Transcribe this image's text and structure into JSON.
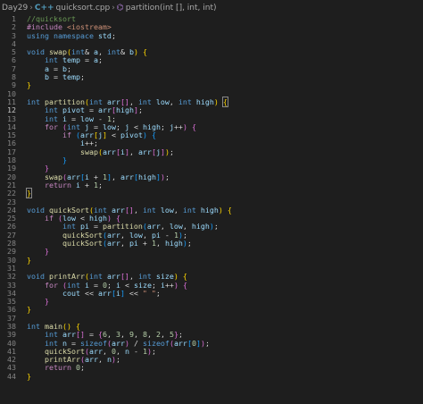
{
  "breadcrumb": {
    "folder": "Day29",
    "file_icon": "C++",
    "file": "quicksort.cpp",
    "symbol": "partition(int [], int, int)"
  },
  "editor": {
    "active_line": 12,
    "lines": [
      [
        [
          "//quicksort",
          "cmt"
        ]
      ],
      [
        [
          "#include ",
          "ctrl"
        ],
        [
          "<iostream>",
          "inc"
        ]
      ],
      [
        [
          "using ",
          "kw"
        ],
        [
          "namespace ",
          "kw"
        ],
        [
          "std",
          "var"
        ],
        [
          ";",
          ""
        ]
      ],
      [],
      [
        [
          "void ",
          "kw"
        ],
        [
          "swap",
          "fn"
        ],
        [
          "(",
          "b1"
        ],
        [
          "int",
          "kw"
        ],
        [
          "& ",
          ""
        ],
        [
          "a",
          "var"
        ],
        [
          ", ",
          ""
        ],
        [
          "int",
          "kw"
        ],
        [
          "& ",
          ""
        ],
        [
          "b",
          "var"
        ],
        [
          ")",
          "b1"
        ],
        [
          " ",
          ""
        ],
        [
          "{",
          "b1"
        ]
      ],
      [
        [
          "    ",
          ""
        ],
        [
          "int ",
          "kw"
        ],
        [
          "temp",
          "var"
        ],
        [
          " = ",
          ""
        ],
        [
          "a",
          "var"
        ],
        [
          ";",
          ""
        ]
      ],
      [
        [
          "    ",
          ""
        ],
        [
          "a",
          "var"
        ],
        [
          " = ",
          ""
        ],
        [
          "b",
          "var"
        ],
        [
          ";",
          ""
        ]
      ],
      [
        [
          "    ",
          ""
        ],
        [
          "b",
          "var"
        ],
        [
          " = ",
          ""
        ],
        [
          "temp",
          "var"
        ],
        [
          ";",
          ""
        ]
      ],
      [
        [
          "}",
          "b1"
        ]
      ],
      [],
      [
        [
          "int ",
          "kw"
        ],
        [
          "partition",
          "fn"
        ],
        [
          "(",
          "b1"
        ],
        [
          "int ",
          "kw"
        ],
        [
          "arr",
          "var"
        ],
        [
          "[]",
          "b2"
        ],
        [
          ", ",
          ""
        ],
        [
          "int ",
          "kw"
        ],
        [
          "low",
          "var"
        ],
        [
          ", ",
          ""
        ],
        [
          "int ",
          "kw"
        ],
        [
          "high",
          "var"
        ],
        [
          ")",
          "b1"
        ],
        [
          " ",
          ""
        ],
        [
          "{",
          "b1"
        ]
      ],
      [
        [
          "    ",
          ""
        ],
        [
          "int ",
          "kw"
        ],
        [
          "pivot",
          "var"
        ],
        [
          " = ",
          ""
        ],
        [
          "arr",
          "var"
        ],
        [
          "[",
          "b2"
        ],
        [
          "high",
          "var"
        ],
        [
          "]",
          "b2"
        ],
        [
          ";",
          ""
        ]
      ],
      [
        [
          "    ",
          ""
        ],
        [
          "int ",
          "kw"
        ],
        [
          "i",
          "var"
        ],
        [
          " = ",
          ""
        ],
        [
          "low",
          "var"
        ],
        [
          " - ",
          ""
        ],
        [
          "1",
          "num"
        ],
        [
          ";",
          ""
        ]
      ],
      [
        [
          "    ",
          ""
        ],
        [
          "for ",
          "ctrl"
        ],
        [
          "(",
          "b2"
        ],
        [
          "int ",
          "kw"
        ],
        [
          "j",
          "var"
        ],
        [
          " = ",
          ""
        ],
        [
          "low",
          "var"
        ],
        [
          "; ",
          ""
        ],
        [
          "j",
          "var"
        ],
        [
          " < ",
          ""
        ],
        [
          "high",
          "var"
        ],
        [
          "; ",
          ""
        ],
        [
          "j",
          "var"
        ],
        [
          "++",
          ""
        ],
        [
          ")",
          "b2"
        ],
        [
          " ",
          ""
        ],
        [
          "{",
          "b2"
        ]
      ],
      [
        [
          "        ",
          ""
        ],
        [
          "if ",
          "ctrl"
        ],
        [
          "(",
          "b3"
        ],
        [
          "arr",
          "var"
        ],
        [
          "[",
          "b1"
        ],
        [
          "j",
          "var"
        ],
        [
          "]",
          "b1"
        ],
        [
          " < ",
          ""
        ],
        [
          "pivot",
          "var"
        ],
        [
          ")",
          "b3"
        ],
        [
          " ",
          ""
        ],
        [
          "{",
          "b3"
        ]
      ],
      [
        [
          "            ",
          ""
        ],
        [
          "i",
          "var"
        ],
        [
          "++;",
          ""
        ]
      ],
      [
        [
          "            ",
          ""
        ],
        [
          "swap",
          "fn"
        ],
        [
          "(",
          "b1"
        ],
        [
          "arr",
          "var"
        ],
        [
          "[",
          "b2"
        ],
        [
          "i",
          "var"
        ],
        [
          "]",
          "b2"
        ],
        [
          ", ",
          ""
        ],
        [
          "arr",
          "var"
        ],
        [
          "[",
          "b2"
        ],
        [
          "j",
          "var"
        ],
        [
          "]",
          "b2"
        ],
        [
          ")",
          "b1"
        ],
        [
          ";",
          ""
        ]
      ],
      [
        [
          "        ",
          ""
        ],
        [
          "}",
          "b3"
        ]
      ],
      [
        [
          "    ",
          ""
        ],
        [
          "}",
          "b2"
        ]
      ],
      [
        [
          "    ",
          ""
        ],
        [
          "swap",
          "fn"
        ],
        [
          "(",
          "b2"
        ],
        [
          "arr",
          "var"
        ],
        [
          "[",
          "b3"
        ],
        [
          "i",
          "var"
        ],
        [
          " + ",
          ""
        ],
        [
          "1",
          "num"
        ],
        [
          "]",
          "b3"
        ],
        [
          ", ",
          ""
        ],
        [
          "arr",
          "var"
        ],
        [
          "[",
          "b3"
        ],
        [
          "high",
          "var"
        ],
        [
          "]",
          "b3"
        ],
        [
          ")",
          "b2"
        ],
        [
          ";",
          ""
        ]
      ],
      [
        [
          "    ",
          ""
        ],
        [
          "return ",
          "ctrl"
        ],
        [
          "i",
          "var"
        ],
        [
          " + ",
          ""
        ],
        [
          "1",
          "num"
        ],
        [
          ";",
          ""
        ]
      ],
      [
        [
          "}",
          "b1"
        ]
      ],
      [],
      [
        [
          "void ",
          "kw"
        ],
        [
          "quickSort",
          "fn"
        ],
        [
          "(",
          "b1"
        ],
        [
          "int ",
          "kw"
        ],
        [
          "arr",
          "var"
        ],
        [
          "[]",
          "b2"
        ],
        [
          ", ",
          ""
        ],
        [
          "int ",
          "kw"
        ],
        [
          "low",
          "var"
        ],
        [
          ", ",
          ""
        ],
        [
          "int ",
          "kw"
        ],
        [
          "high",
          "var"
        ],
        [
          ")",
          "b1"
        ],
        [
          " ",
          ""
        ],
        [
          "{",
          "b1"
        ]
      ],
      [
        [
          "    ",
          ""
        ],
        [
          "if ",
          "ctrl"
        ],
        [
          "(",
          "b2"
        ],
        [
          "low",
          "var"
        ],
        [
          " < ",
          ""
        ],
        [
          "high",
          "var"
        ],
        [
          ")",
          "b2"
        ],
        [
          " ",
          ""
        ],
        [
          "{",
          "b2"
        ]
      ],
      [
        [
          "        ",
          ""
        ],
        [
          "int ",
          "kw"
        ],
        [
          "pi",
          "var"
        ],
        [
          " = ",
          ""
        ],
        [
          "partition",
          "fn"
        ],
        [
          "(",
          "b3"
        ],
        [
          "arr",
          "var"
        ],
        [
          ", ",
          ""
        ],
        [
          "low",
          "var"
        ],
        [
          ", ",
          ""
        ],
        [
          "high",
          "var"
        ],
        [
          ")",
          "b3"
        ],
        [
          ";",
          ""
        ]
      ],
      [
        [
          "        ",
          ""
        ],
        [
          "quickSort",
          "fn"
        ],
        [
          "(",
          "b3"
        ],
        [
          "arr",
          "var"
        ],
        [
          ", ",
          ""
        ],
        [
          "low",
          "var"
        ],
        [
          ", ",
          ""
        ],
        [
          "pi",
          "var"
        ],
        [
          " - ",
          ""
        ],
        [
          "1",
          "num"
        ],
        [
          ")",
          "b3"
        ],
        [
          ";",
          ""
        ]
      ],
      [
        [
          "        ",
          ""
        ],
        [
          "quickSort",
          "fn"
        ],
        [
          "(",
          "b3"
        ],
        [
          "arr",
          "var"
        ],
        [
          ", ",
          ""
        ],
        [
          "pi",
          "var"
        ],
        [
          " + ",
          ""
        ],
        [
          "1",
          "num"
        ],
        [
          ", ",
          ""
        ],
        [
          "high",
          "var"
        ],
        [
          ")",
          "b3"
        ],
        [
          ";",
          ""
        ]
      ],
      [
        [
          "    ",
          ""
        ],
        [
          "}",
          "b2"
        ]
      ],
      [
        [
          "}",
          "b1"
        ]
      ],
      [],
      [
        [
          "void ",
          "kw"
        ],
        [
          "printArr",
          "fn"
        ],
        [
          "(",
          "b1"
        ],
        [
          "int ",
          "kw"
        ],
        [
          "arr",
          "var"
        ],
        [
          "[]",
          "b2"
        ],
        [
          ", ",
          ""
        ],
        [
          "int ",
          "kw"
        ],
        [
          "size",
          "var"
        ],
        [
          ")",
          "b1"
        ],
        [
          " ",
          ""
        ],
        [
          "{",
          "b1"
        ]
      ],
      [
        [
          "    ",
          ""
        ],
        [
          "for ",
          "ctrl"
        ],
        [
          "(",
          "b2"
        ],
        [
          "int ",
          "kw"
        ],
        [
          "i",
          "var"
        ],
        [
          " = ",
          ""
        ],
        [
          "0",
          "num"
        ],
        [
          "; ",
          ""
        ],
        [
          "i",
          "var"
        ],
        [
          " < ",
          ""
        ],
        [
          "size",
          "var"
        ],
        [
          "; ",
          ""
        ],
        [
          "i",
          "var"
        ],
        [
          "++",
          ""
        ],
        [
          ")",
          "b2"
        ],
        [
          " ",
          ""
        ],
        [
          "{",
          "b2"
        ]
      ],
      [
        [
          "        ",
          ""
        ],
        [
          "cout",
          "var"
        ],
        [
          " << ",
          ""
        ],
        [
          "arr",
          "var"
        ],
        [
          "[",
          "b3"
        ],
        [
          "i",
          "var"
        ],
        [
          "]",
          "b3"
        ],
        [
          " << ",
          ""
        ],
        [
          "\" \"",
          "str"
        ],
        [
          ";",
          ""
        ]
      ],
      [
        [
          "    ",
          ""
        ],
        [
          "}",
          "b2"
        ]
      ],
      [
        [
          "}",
          "b1"
        ]
      ],
      [],
      [
        [
          "int ",
          "kw"
        ],
        [
          "main",
          "fn"
        ],
        [
          "(",
          "b1"
        ],
        [
          ")",
          "b1"
        ],
        [
          " ",
          ""
        ],
        [
          "{",
          "b1"
        ]
      ],
      [
        [
          "    ",
          ""
        ],
        [
          "int ",
          "kw"
        ],
        [
          "arr",
          "var"
        ],
        [
          "[]",
          "b2"
        ],
        [
          " = ",
          ""
        ],
        [
          "{",
          "b2"
        ],
        [
          "6",
          "num"
        ],
        [
          ", ",
          ""
        ],
        [
          "3",
          "num"
        ],
        [
          ", ",
          ""
        ],
        [
          "9",
          "num"
        ],
        [
          ", ",
          ""
        ],
        [
          "8",
          "num"
        ],
        [
          ", ",
          ""
        ],
        [
          "2",
          "num"
        ],
        [
          ", ",
          ""
        ],
        [
          "5",
          "num"
        ],
        [
          "}",
          "b2"
        ],
        [
          ";",
          ""
        ]
      ],
      [
        [
          "    ",
          ""
        ],
        [
          "int ",
          "kw"
        ],
        [
          "n",
          "var"
        ],
        [
          " = ",
          ""
        ],
        [
          "sizeof",
          "kw"
        ],
        [
          "(",
          "b2"
        ],
        [
          "arr",
          "var"
        ],
        [
          ")",
          "b2"
        ],
        [
          " / ",
          ""
        ],
        [
          "sizeof",
          "kw"
        ],
        [
          "(",
          "b2"
        ],
        [
          "arr",
          "var"
        ],
        [
          "[",
          "b3"
        ],
        [
          "0",
          "num"
        ],
        [
          "]",
          "b3"
        ],
        [
          ")",
          "b2"
        ],
        [
          ";",
          ""
        ]
      ],
      [
        [
          "    ",
          ""
        ],
        [
          "quickSort",
          "fn"
        ],
        [
          "(",
          "b2"
        ],
        [
          "arr",
          "var"
        ],
        [
          ", ",
          ""
        ],
        [
          "0",
          "num"
        ],
        [
          ", ",
          ""
        ],
        [
          "n",
          "var"
        ],
        [
          " - ",
          ""
        ],
        [
          "1",
          "num"
        ],
        [
          ")",
          "b2"
        ],
        [
          ";",
          ""
        ]
      ],
      [
        [
          "    ",
          ""
        ],
        [
          "printArr",
          "fn"
        ],
        [
          "(",
          "b2"
        ],
        [
          "arr",
          "var"
        ],
        [
          ", ",
          ""
        ],
        [
          "n",
          "var"
        ],
        [
          ")",
          "b2"
        ],
        [
          ";",
          ""
        ]
      ],
      [
        [
          "    ",
          ""
        ],
        [
          "return ",
          "ctrl"
        ],
        [
          "0",
          "num"
        ],
        [
          ";",
          ""
        ]
      ],
      [
        [
          "}",
          "b1"
        ]
      ]
    ]
  }
}
